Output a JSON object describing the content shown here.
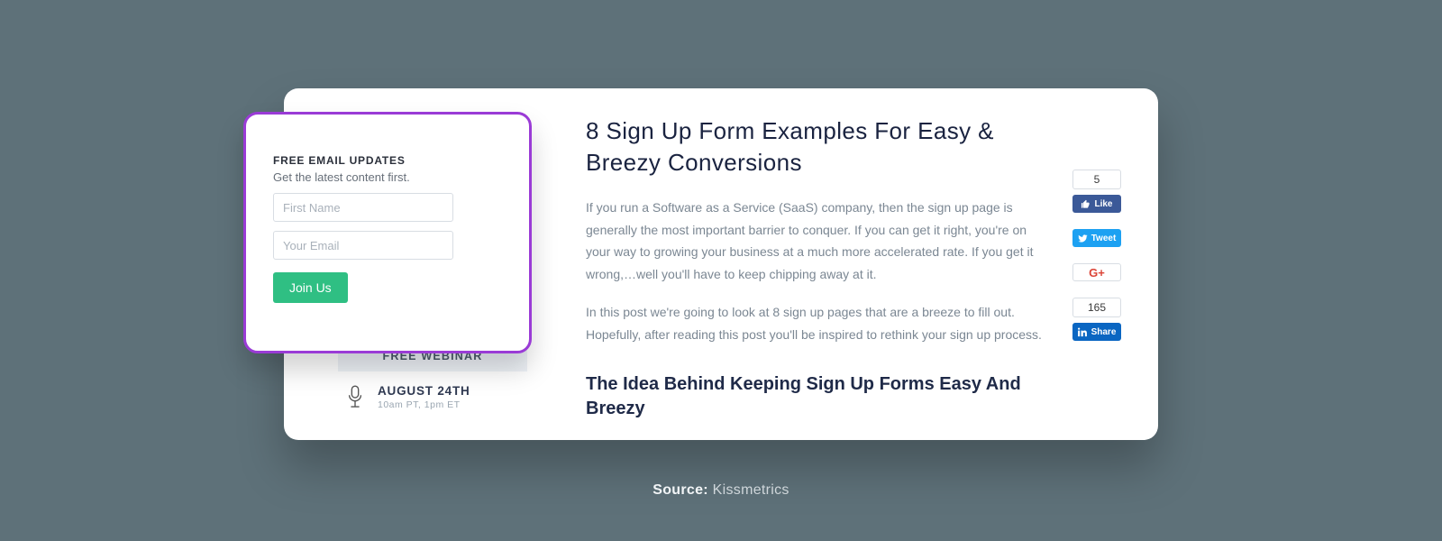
{
  "signup": {
    "title": "FREE EMAIL UPDATES",
    "subtitle": "Get the latest content first.",
    "first_name_placeholder": "First Name",
    "email_placeholder": "Your Email",
    "button_label": "Join Us"
  },
  "webinar": {
    "header": "FREE WEBINAR",
    "date": "AUGUST 24TH",
    "time": "10am PT, 1pm ET"
  },
  "article": {
    "title": "8 Sign Up Form Examples For Easy & Breezy Conversions",
    "p1": "If you run a Software as a Service (SaaS) company, then the sign up page is generally the most important barrier to conquer. If you can get it right, you're on your way to growing your business at a much more accelerated rate. If you get it wrong,…well you'll have to keep chipping away at it.",
    "p2": "In this post we're going to look at 8 sign up pages that are a breeze to fill out. Hopefully, after reading this post you'll be inspired to rethink your sign up process.",
    "subheading": "The Idea Behind Keeping Sign Up Forms Easy And Breezy"
  },
  "social": {
    "fb_count": "5",
    "fb_label": "Like",
    "tw_label": "Tweet",
    "gp_label": "G+",
    "li_count": "165",
    "li_label": "Share"
  },
  "caption": {
    "label": "Source:",
    "value": "Kissmetrics"
  }
}
